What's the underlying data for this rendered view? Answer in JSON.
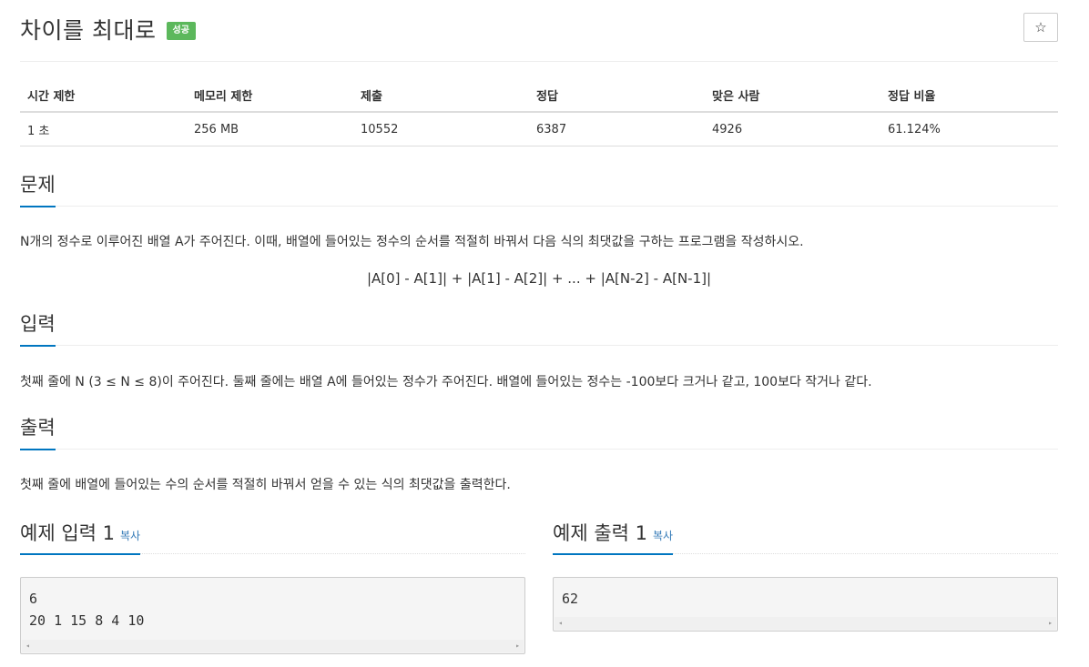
{
  "problem": {
    "title": "차이를 최대로",
    "badge": "성공"
  },
  "info_table": {
    "headers": [
      "시간 제한",
      "메모리 제한",
      "제출",
      "정답",
      "맞은 사람",
      "정답 비율"
    ],
    "values": [
      "1 초",
      "256 MB",
      "10552",
      "6387",
      "4926",
      "61.124%"
    ]
  },
  "sections": {
    "problem": {
      "heading": "문제",
      "text": "N개의 정수로 이루어진 배열 A가 주어진다. 이때, 배열에 들어있는 정수의 순서를 적절히 바꿔서 다음 식의 최댓값을 구하는 프로그램을 작성하시오.",
      "formula": "|A[0] - A[1]| + |A[1] - A[2]| + ... + |A[N-2] - A[N-1]|"
    },
    "input": {
      "heading": "입력",
      "text": "첫째 줄에 N (3 ≤ N ≤ 8)이 주어진다. 둘째 줄에는 배열 A에 들어있는 정수가 주어진다. 배열에 들어있는 정수는 -100보다 크거나 같고, 100보다 작거나 같다."
    },
    "output": {
      "heading": "출력",
      "text": "첫째 줄에 배열에 들어있는 수의 순서를 적절히 바꿔서 얻을 수 있는 식의 최댓값을 출력한다."
    }
  },
  "samples": {
    "input": {
      "heading": "예제 입력 1",
      "copy_label": "복사",
      "lines": [
        "6",
        "20 1 15 8 4 10"
      ]
    },
    "output": {
      "heading": "예제 출력 1",
      "copy_label": "복사",
      "lines": [
        "62"
      ]
    }
  },
  "icons": {
    "star": "star-icon",
    "scroll_left": "scroll-left-icon",
    "scroll_right": "scroll-right-icon"
  },
  "colors": {
    "accent": "#0076c0",
    "success_badge": "#5cb85c",
    "link": "#337ab7"
  }
}
